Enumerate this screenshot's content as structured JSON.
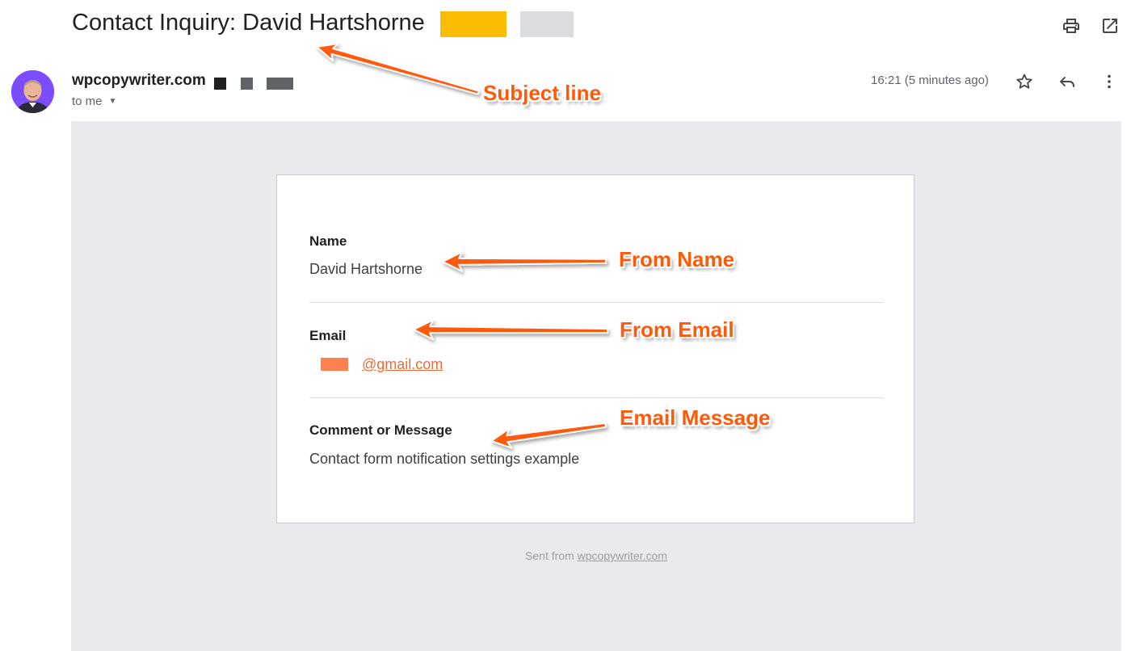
{
  "subject": "Contact Inquiry: David Hartshorne",
  "sender": {
    "name": "wpcopywriter.com",
    "to": "to me",
    "timestamp": "16:21 (5 minutes ago)"
  },
  "form": {
    "fields": [
      {
        "label": "Name",
        "value": "David Hartshorne"
      },
      {
        "label": "Email",
        "value": "@gmail.com"
      },
      {
        "label": "Comment or Message",
        "value": "Contact form notification settings example"
      }
    ]
  },
  "footer": {
    "prefix": "Sent from",
    "link": "wpcopywriter.com"
  },
  "annotations": {
    "subject": "Subject line",
    "name": "From Name",
    "email": "From Email",
    "message": "Email Message"
  },
  "colors": {
    "annotation": "#ff5a0a",
    "label_yellow": "#fbbc04",
    "label_gray": "#dadce0",
    "body_background": "#e8eaed",
    "link": "#f06a33"
  },
  "icons": [
    "print-icon",
    "open-in-new-icon",
    "star-icon",
    "reply-icon",
    "more-vert-icon",
    "caret-down-icon"
  ]
}
